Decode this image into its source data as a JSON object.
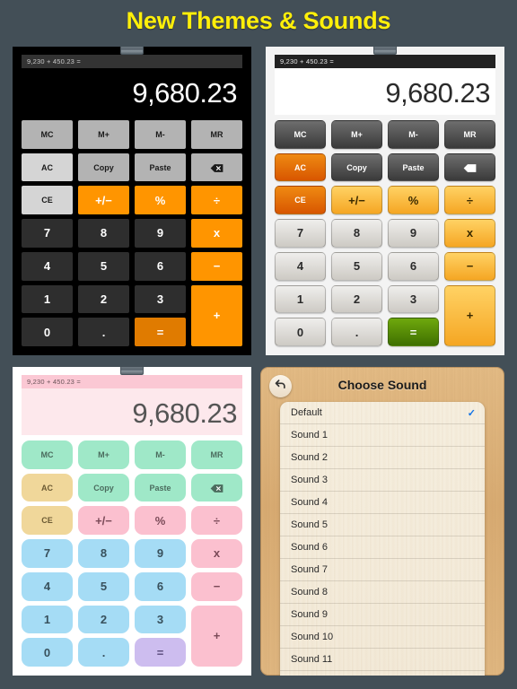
{
  "headline": "New Themes & Sounds",
  "colors": {
    "background": "#434f57",
    "headline": "#ffef0a",
    "dark_operator": "#ff9500",
    "dark_equals": "#e07b00",
    "light_equals_green": "#3f7000",
    "light_ac_orange": "#d85600",
    "pastel_mint": "#9fe8c8",
    "pastel_blue": "#a5dcf5",
    "pastel_pink": "#fbc0cf",
    "pastel_lavender": "#cdbdef",
    "checkmark_blue": "#1273e6",
    "wood": "#d8ab72"
  },
  "calculator": {
    "history": "9,230 + 450.23 =",
    "display": "9,680.23",
    "keys": [
      {
        "label": "MC",
        "name": "memory-clear-button",
        "style": "mem",
        "size": "small"
      },
      {
        "label": "M+",
        "name": "memory-add-button",
        "style": "mem",
        "size": "small"
      },
      {
        "label": "M-",
        "name": "memory-subtract-button",
        "style": "mem",
        "size": "small"
      },
      {
        "label": "MR",
        "name": "memory-recall-button",
        "style": "mem",
        "size": "small"
      },
      {
        "label": "AC",
        "name": "all-clear-button",
        "style": "ac",
        "size": "small"
      },
      {
        "label": "Copy",
        "name": "copy-button",
        "style": "mem",
        "size": "small"
      },
      {
        "label": "Paste",
        "name": "paste-button",
        "style": "mem",
        "size": "small"
      },
      {
        "label": "",
        "name": "backspace-icon-button",
        "style": "mem",
        "size": "icon"
      },
      {
        "label": "CE",
        "name": "clear-entry-button",
        "style": "ac",
        "size": "small"
      },
      {
        "label": "+/−",
        "name": "sign-toggle-button",
        "style": "opr",
        "size": "op"
      },
      {
        "label": "%",
        "name": "percent-button",
        "style": "opr",
        "size": "op"
      },
      {
        "label": "÷",
        "name": "divide-button",
        "style": "opr",
        "size": "op"
      },
      {
        "label": "7",
        "name": "digit-7-button",
        "style": "num",
        "size": "num"
      },
      {
        "label": "8",
        "name": "digit-8-button",
        "style": "num",
        "size": "num"
      },
      {
        "label": "9",
        "name": "digit-9-button",
        "style": "num",
        "size": "num"
      },
      {
        "label": "x",
        "name": "multiply-button",
        "style": "opr",
        "size": "op"
      },
      {
        "label": "4",
        "name": "digit-4-button",
        "style": "num",
        "size": "num"
      },
      {
        "label": "5",
        "name": "digit-5-button",
        "style": "num",
        "size": "num"
      },
      {
        "label": "6",
        "name": "digit-6-button",
        "style": "num",
        "size": "num"
      },
      {
        "label": "−",
        "name": "subtract-button",
        "style": "opr",
        "size": "op"
      },
      {
        "label": "1",
        "name": "digit-1-button",
        "style": "num",
        "size": "num"
      },
      {
        "label": "2",
        "name": "digit-2-button",
        "style": "num",
        "size": "num"
      },
      {
        "label": "3",
        "name": "digit-3-button",
        "style": "num",
        "size": "num"
      },
      {
        "label": "+",
        "name": "add-button",
        "style": "opr",
        "size": "op",
        "tall": true
      },
      {
        "label": "0",
        "name": "digit-0-button",
        "style": "num",
        "size": "num"
      },
      {
        "label": ".",
        "name": "decimal-point-button",
        "style": "num",
        "size": "num"
      },
      {
        "label": "=",
        "name": "equals-button",
        "style": "eq",
        "size": "op"
      }
    ]
  },
  "themes": [
    {
      "id": "dark",
      "name": "dark-theme-calculator"
    },
    {
      "id": "light",
      "name": "light-theme-calculator"
    },
    {
      "id": "pastel",
      "name": "pastel-theme-calculator"
    }
  ],
  "sound_panel": {
    "title": "Choose Sound",
    "back_icon": "back-arrow-icon",
    "selected": "Default",
    "check_glyph": "✓",
    "items": [
      {
        "label": "Default",
        "selected": true
      },
      {
        "label": "Sound 1",
        "selected": false
      },
      {
        "label": "Sound 2",
        "selected": false
      },
      {
        "label": "Sound 3",
        "selected": false
      },
      {
        "label": "Sound 4",
        "selected": false
      },
      {
        "label": "Sound 5",
        "selected": false
      },
      {
        "label": "Sound 6",
        "selected": false
      },
      {
        "label": "Sound 7",
        "selected": false
      },
      {
        "label": "Sound 8",
        "selected": false
      },
      {
        "label": "Sound 9",
        "selected": false
      },
      {
        "label": "Sound 10",
        "selected": false
      },
      {
        "label": "Sound 11",
        "selected": false
      }
    ]
  }
}
